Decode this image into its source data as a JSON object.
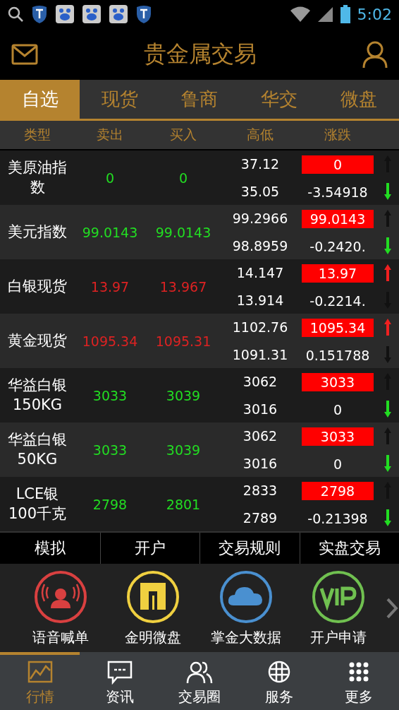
{
  "status_bar": {
    "time": "5:02"
  },
  "header": {
    "title": "贵金属交易"
  },
  "tabs": [
    {
      "label": "自选",
      "selected": true
    },
    {
      "label": "现货",
      "selected": false
    },
    {
      "label": "鲁商",
      "selected": false
    },
    {
      "label": "华交",
      "selected": false
    },
    {
      "label": "微盘",
      "selected": false
    }
  ],
  "table": {
    "columns": [
      "类型",
      "卖出",
      "买入",
      "高低",
      "涨跌"
    ],
    "rows": [
      {
        "name": "美原油指数",
        "sell": "0",
        "buy": "0",
        "color": "#22dd22",
        "high": "37.12",
        "low": "35.05",
        "change": "0",
        "change_pct": "-3.54918",
        "up_on": false,
        "down_on": true
      },
      {
        "name": "美元指数",
        "sell": "99.0143",
        "buy": "99.0143",
        "color": "#22dd22",
        "high": "99.2966",
        "low": "98.8959",
        "change": "99.0143",
        "change_pct": "-0.2420.",
        "up_on": false,
        "down_on": true
      },
      {
        "name": "白银现货",
        "sell": "13.97",
        "buy": "13.967",
        "color": "#dd2222",
        "high": "14.147",
        "low": "13.914",
        "change": "13.97",
        "change_pct": "-0.2214.",
        "up_on": true,
        "down_on": false
      },
      {
        "name": "黄金现货",
        "sell": "1095.34",
        "buy": "1095.31",
        "color": "#dd2222",
        "high": "1102.76",
        "low": "1091.31",
        "change": "1095.34",
        "change_pct": "0.151788",
        "up_on": true,
        "down_on": false
      },
      {
        "name": "华益白银150KG",
        "sell": "3033",
        "buy": "3039",
        "color": "#22dd22",
        "high": "3062",
        "low": "3016",
        "change": "3033",
        "change_pct": "0",
        "up_on": false,
        "down_on": true
      },
      {
        "name": "华益白银50KG",
        "sell": "3033",
        "buy": "3039",
        "color": "#22dd22",
        "high": "3062",
        "low": "3016",
        "change": "3033",
        "change_pct": "0",
        "up_on": false,
        "down_on": true
      },
      {
        "name": "LCE银100千克",
        "sell": "2798",
        "buy": "2801",
        "color": "#22dd22",
        "high": "2833",
        "low": "2789",
        "change": "2798",
        "change_pct": "-0.21398",
        "up_on": false,
        "down_on": true
      }
    ]
  },
  "action_bar": [
    "模拟",
    "开户",
    "交易规则",
    "实盘交易"
  ],
  "features": [
    {
      "kind": "voice",
      "label": "语音喊单",
      "color": "#d94040"
    },
    {
      "kind": "logo",
      "label": "金明微盘",
      "color": "#f0d040"
    },
    {
      "kind": "cloud",
      "label": "掌金大数据",
      "color": "#4a90d0"
    },
    {
      "kind": "vip",
      "label": "开户申请",
      "color": "#70c050"
    }
  ],
  "bottom_nav": [
    {
      "kind": "chart",
      "label": "行情",
      "selected": true
    },
    {
      "kind": "chat",
      "label": "资讯",
      "selected": false
    },
    {
      "kind": "people",
      "label": "交易圈",
      "selected": false
    },
    {
      "kind": "globe",
      "label": "服务",
      "selected": false
    },
    {
      "kind": "grid",
      "label": "更多",
      "selected": false
    }
  ]
}
